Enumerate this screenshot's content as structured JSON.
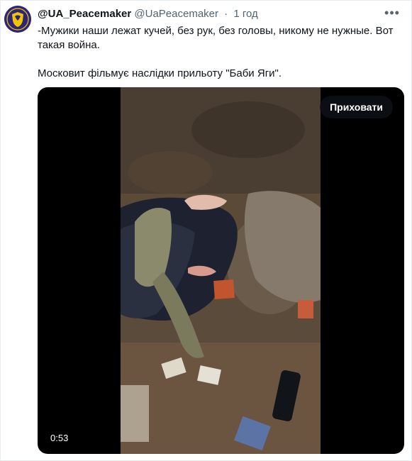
{
  "tweet": {
    "display_name": "@UA_Peacemaker",
    "handle": "@UaPeacemaker",
    "separator": "·",
    "time": "1 год",
    "text": "-Мужики наши лежат кучей, без рук, без головы, никому не нужные. Вот такая война.\n\nМосковит фільмує наслідки прильоту \"Баби Яги\"."
  },
  "avatar": {
    "icon": "shield-avatar-icon",
    "bg_color": "#2d2578",
    "accent": "#f2c500"
  },
  "more_icon": "more-horizontal-icon",
  "media": {
    "hide_button_label": "Приховати",
    "duration": "0:53"
  }
}
